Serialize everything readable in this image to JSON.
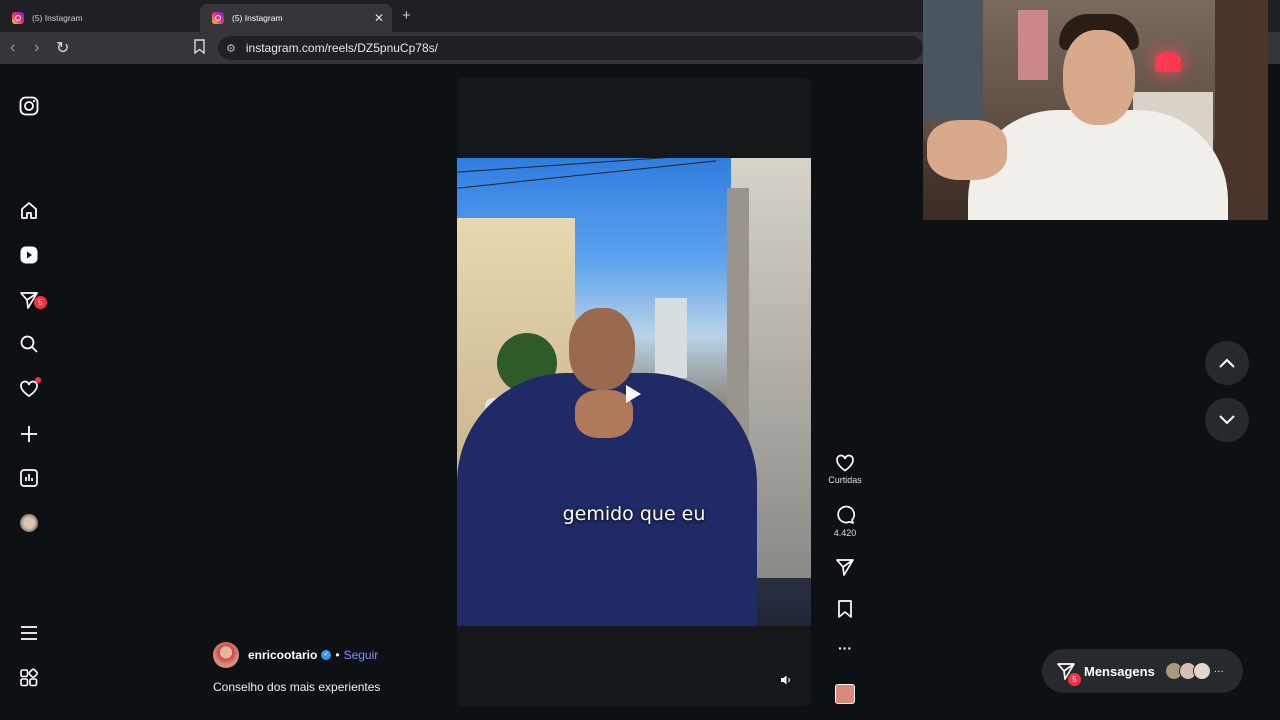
{
  "browser": {
    "tabs": [
      {
        "title": "(5) Instagram",
        "active": false
      },
      {
        "title": "(5) Instagram",
        "active": true
      }
    ],
    "new_tab": "+",
    "close": "✕",
    "url": "instagram.com/reels/DZ5pnuCp78s/"
  },
  "sidebar": {
    "notifications_badge": "5"
  },
  "reel": {
    "subtitle": "gemido que eu",
    "author": "enricootario",
    "separator": "•",
    "follow_label": "Seguir",
    "caption": "Conselho dos mais experientes"
  },
  "actions": {
    "likes_label": "Curtidas",
    "comments_count": "4.420",
    "more": "···"
  },
  "messages": {
    "label": "Mensagens",
    "badge": "5",
    "more": "···"
  },
  "colors": {
    "accent_link": "#7e8fff",
    "badge": "#ff3040",
    "verified": "#3897f0"
  }
}
